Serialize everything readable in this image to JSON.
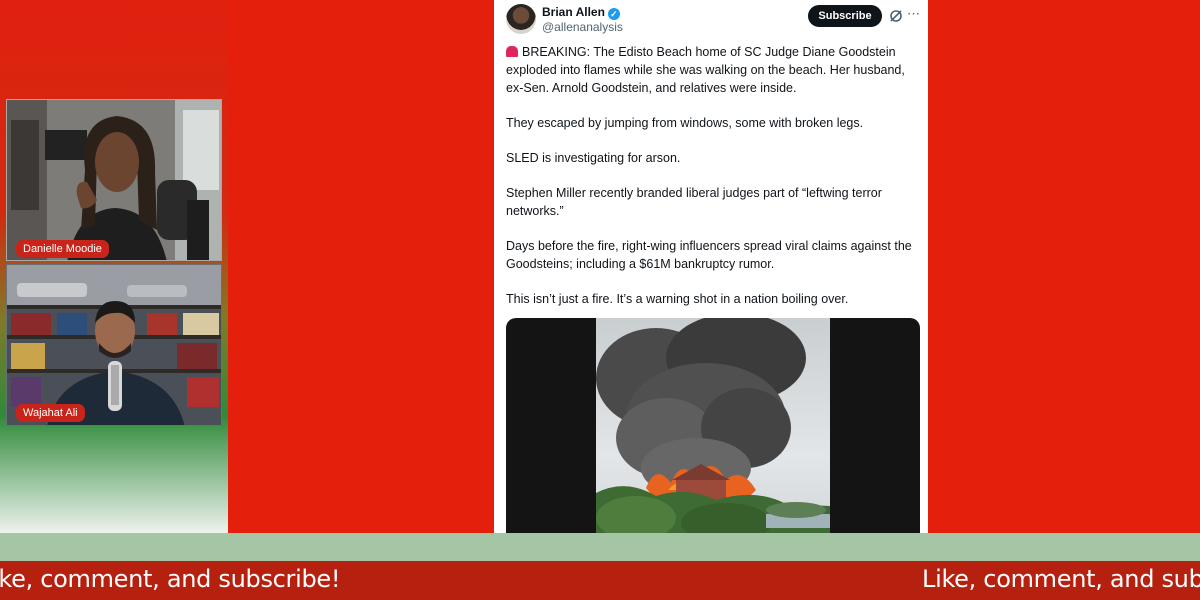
{
  "participants": [
    {
      "name": "Danielle Moodie"
    },
    {
      "name": "Wajahat Ali"
    }
  ],
  "tweet": {
    "author_name": "Brian Allen",
    "handle": "@allenanalysis",
    "subscribe_label": "Subscribe",
    "more_icon": "⋯",
    "paragraphs": [
      "BREAKING: The Edisto Beach home of SC Judge Diane Goodstein exploded into flames while she was walking on the beach. Her husband, ex-Sen. Arnold Goodstein, and relatives were inside.",
      "They escaped by jumping from windows, some with broken legs.",
      "SLED is investigating for arson.",
      "Stephen Miller recently branded liberal judges part of “leftwing terror networks.”",
      "Days before the fire, right-wing influencers spread viral claims against the Goodsteins; including a $61M bankruptcy rumor.",
      "This isn’t just a fire. It’s a warning shot in a nation boiling over."
    ]
  },
  "ticker": {
    "text_left": "ike, comment, and subscribe!",
    "text_right": "Like, comment, and subs"
  },
  "colors": {
    "background_red": "#e0210f",
    "ticker_red": "#b6200f",
    "strip_green": "#a4c6a4",
    "name_tag_red": "#c8241a",
    "verified_blue": "#1d9bf0"
  },
  "icons": [
    "verified-badge-icon",
    "grok-icon",
    "more-icon",
    "siren-icon"
  ]
}
